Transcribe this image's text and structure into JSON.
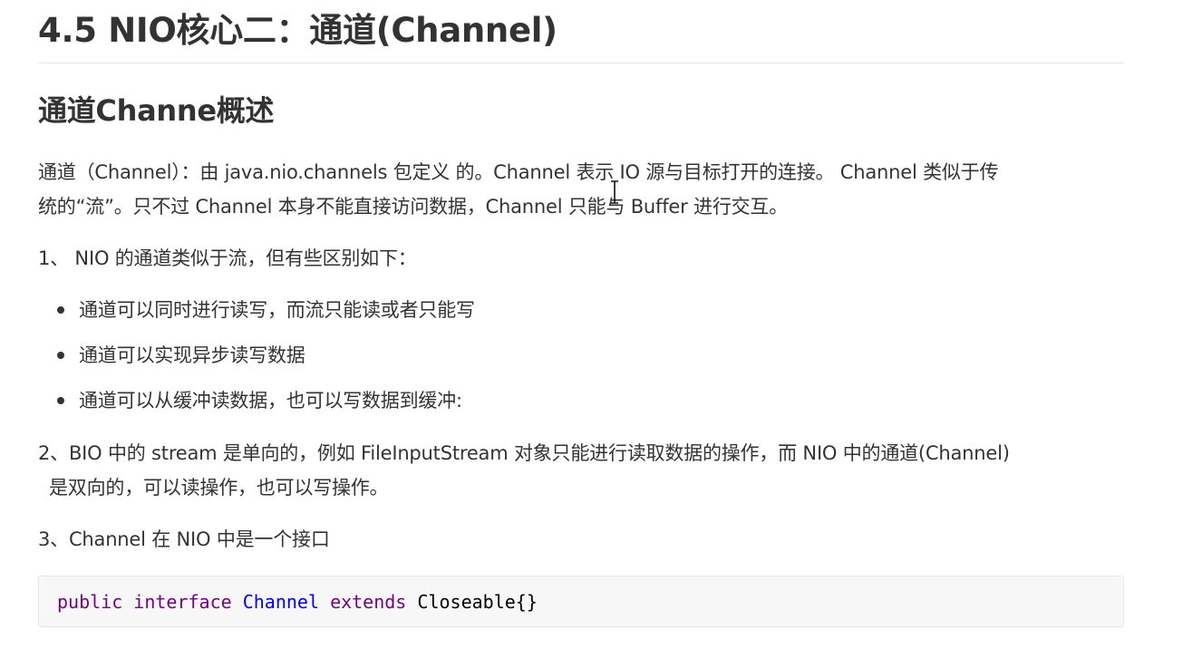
{
  "heading": "4.5 NIO核心二：通道(Channel)",
  "subheading": "通道Channe概述",
  "intro": {
    "line1": "通道（Channel）：由 java.nio.channels 包定义 的。Channel 表示 IO 源与目标打开的连接。 Channel 类似于传",
    "line2": "统的“流”。只不过 Channel 本身不能直接访问数据，Channel 只能与 Buffer 进行交互。"
  },
  "point1": "1、 NIO 的通道类似于流，但有些区别如下：",
  "bullets": [
    "通道可以同时进行读写，而流只能读或者只能写",
    "通道可以实现异步读写数据",
    "通道可以从缓冲读数据，也可以写数据到缓冲:"
  ],
  "point2": {
    "line1": "2、BIO 中的 stream 是单向的，例如 FileInputStream 对象只能进行读取数据的操作，而 NIO 中的通道(Channel)",
    "line2": "是双向的，可以读操作，也可以写操作。"
  },
  "point3": "3、Channel 在 NIO 中是一个接口",
  "code": {
    "kw_public": "public",
    "kw_interface": "interface",
    "name": "Channel",
    "kw_extends": "extends",
    "rest": "Closeable{}"
  },
  "colors": {
    "keyword": "#770088",
    "definition": "#0000ff",
    "text": "#333333",
    "code_bg": "#f7f7f7"
  },
  "icons": [
    "text-cursor-icon",
    "bullet-icon"
  ]
}
